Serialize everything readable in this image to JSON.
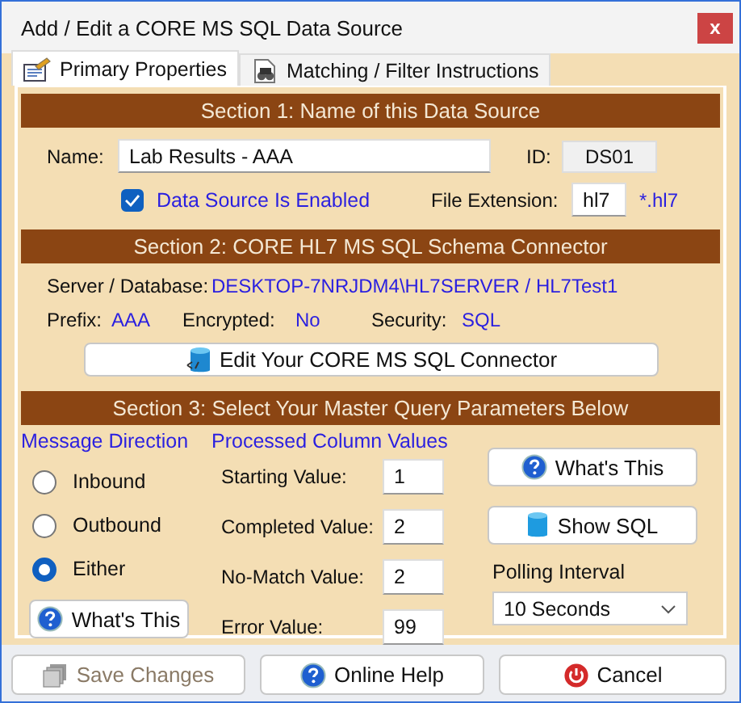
{
  "window": {
    "title": "Add / Edit a CORE MS SQL Data Source",
    "close": "x"
  },
  "tabs": [
    {
      "label": "Primary Properties",
      "selected": true
    },
    {
      "label": "Matching / Filter Instructions",
      "selected": false
    }
  ],
  "section1": {
    "header": "Section 1: Name of this Data Source",
    "name_label": "Name:",
    "name_value": "Lab Results - AAA",
    "id_label": "ID:",
    "id_value": "DS01",
    "enabled": {
      "label": "Data Source Is Enabled",
      "checked": true
    },
    "ext_label": "File Extension:",
    "ext_value": "hl7",
    "ext_pattern": "*.hl7"
  },
  "section2": {
    "header": "Section 2: CORE HL7 MS SQL Schema Connector",
    "server_label": "Server / Database:",
    "server_value": "DESKTOP-7NRJDM4\\HL7SERVER / HL7Test1",
    "fields": [
      {
        "label": "Prefix:",
        "value": "AAA"
      },
      {
        "label": "Encrypted:",
        "value": "No"
      },
      {
        "label": "Security:",
        "value": "SQL"
      }
    ],
    "button": "Edit Your CORE MS SQL Connector"
  },
  "section3": {
    "header": "Section 3: Select Your Master Query Parameters Below",
    "direction_title": "Message Direction",
    "directions": [
      {
        "label": "Inbound",
        "selected": false
      },
      {
        "label": "Outbound",
        "selected": false
      },
      {
        "label": "Either",
        "selected": true
      }
    ],
    "direction_help": "What's This",
    "values_title": "Processed Column Values",
    "values": [
      {
        "label": "Starting Value:",
        "value": "1"
      },
      {
        "label": "Completed Value:",
        "value": "2"
      },
      {
        "label": "No-Match Value:",
        "value": "2"
      },
      {
        "label": "Error Value:",
        "value": "99"
      }
    ],
    "help": "What's This",
    "show_sql": "Show SQL",
    "polling_label": "Polling Interval",
    "polling_value": "10 Seconds"
  },
  "footer": [
    {
      "label": "Save Changes",
      "kind": "save",
      "disabled": true
    },
    {
      "label": "Online Help",
      "kind": "help",
      "disabled": false
    },
    {
      "label": "Cancel",
      "kind": "power",
      "disabled": false
    }
  ]
}
